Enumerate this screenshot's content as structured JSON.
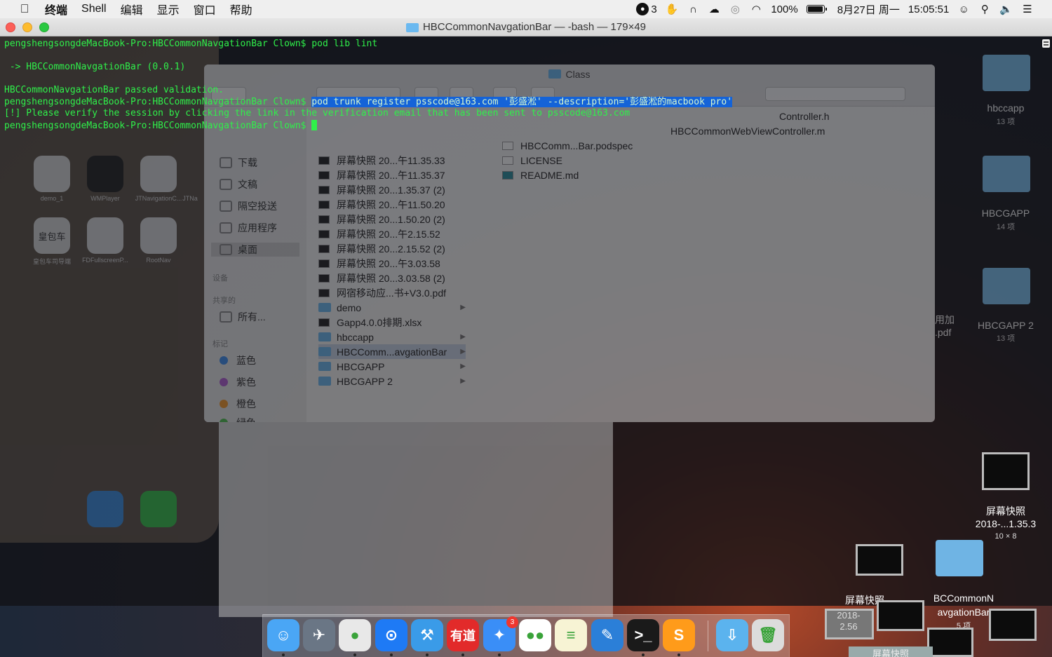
{
  "menubar": {
    "apple_icon": "apple-icon",
    "app_name": "终端",
    "menus": [
      "Shell",
      "编辑",
      "显示",
      "窗口",
      "帮助"
    ],
    "status": {
      "app_badge_count": "3",
      "battery_percent": "100%",
      "battery_level": 1.0,
      "date": "8月27日 周一",
      "time": "15:05:51"
    }
  },
  "terminal": {
    "window_title": "HBCCommonNavgationBar — -bash — 179×49",
    "lines": [
      {
        "pre": "pengshengsongdeMacBook-Pro:HBCCommonNavgationBar Clown$ pod lib lint",
        "hl": "",
        "post": ""
      },
      {
        "pre": "",
        "hl": "",
        "post": ""
      },
      {
        "pre": " -> HBCCommonNavgationBar (0.0.1)",
        "hl": "",
        "post": ""
      },
      {
        "pre": "",
        "hl": "",
        "post": ""
      },
      {
        "pre": "HBCCommonNavgationBar passed validation.",
        "hl": "",
        "post": ""
      },
      {
        "pre": "pengshengsongdeMacBook-Pro:HBCCommonNavgationBar Clown$ ",
        "hl": "pod trunk register psscode@163.com '彭盛淞' --description='彭盛淞的macbook pro'",
        "post": ""
      },
      {
        "pre": "[!] Please verify the session by clicking the link in the verification email that has been sent to psscode@163.com",
        "hl": "",
        "post": ""
      },
      {
        "pre": "pengshengsongdeMacBook-Pro:HBCCommonNavgationBar Clown$ ",
        "hl": "",
        "post": ""
      }
    ]
  },
  "background_finder": {
    "title": "Class",
    "sidebar": {
      "items": [
        "下载",
        "文稿",
        "隔空投送",
        "应用程序",
        "桌面"
      ],
      "sections": [
        "设备",
        "共享的",
        "标记"
      ],
      "shared_item": "所有...",
      "tags": [
        {
          "label": "蓝色",
          "color": "#3f8ff0"
        },
        {
          "label": "紫色",
          "color": "#b35fd6"
        },
        {
          "label": "橙色",
          "color": "#f59a2c"
        },
        {
          "label": "绿色",
          "color": "#4fc24f"
        }
      ]
    },
    "column1": [
      {
        "name": "屏幕快照 20...午11.35.33",
        "kind": "file"
      },
      {
        "name": "屏幕快照 20...午11.35.37",
        "kind": "file"
      },
      {
        "name": "屏幕快照 20...1.35.37 (2)",
        "kind": "file"
      },
      {
        "name": "屏幕快照 20...午11.50.20",
        "kind": "file"
      },
      {
        "name": "屏幕快照 20...1.50.20 (2)",
        "kind": "file"
      },
      {
        "name": "屏幕快照 20...午2.15.52",
        "kind": "file"
      },
      {
        "name": "屏幕快照 20...2.15.52 (2)",
        "kind": "file"
      },
      {
        "name": "屏幕快照 20...午3.03.58",
        "kind": "file"
      },
      {
        "name": "屏幕快照 20...3.03.58 (2)",
        "kind": "file"
      },
      {
        "name": "网宿移动应...书+V3.0.pdf",
        "kind": "file"
      },
      {
        "name": "demo",
        "kind": "folder"
      },
      {
        "name": "Gapp4.0.0排期.xlsx",
        "kind": "file"
      },
      {
        "name": "hbccapp",
        "kind": "folder"
      },
      {
        "name": "HBCComm...avgationBar",
        "kind": "folder"
      },
      {
        "name": "HBCGAPP",
        "kind": "folder"
      },
      {
        "name": "HBCGAPP 2",
        "kind": "folder"
      }
    ],
    "column2": [
      "Controller.h",
      "HBCCommonWebViewController.m",
      "HBCComm...Bar.podspec",
      "LICENSE",
      "README.md"
    ]
  },
  "simulator_ghost": {
    "apps": [
      "demo_1",
      "WMPlayer",
      "JTNavigationC...",
      "JTNa",
      "皇包车司导端",
      "FDFullscreenP...",
      "RootNav"
    ],
    "tile_text": "皇包车"
  },
  "desktop": {
    "items": [
      {
        "label": "hbccapp",
        "sub": "13 项"
      },
      {
        "label": "HBCGAPP",
        "sub": "14 项"
      },
      {
        "label": "HBCGAPP 2",
        "sub": "13 项"
      }
    ],
    "partial_label": "用加",
    "partial_sub": ".pdf",
    "screenshot_label": "屏幕快照",
    "screenshot_sub": "2018-...1.35.3",
    "screenshot_size": "10 × 8",
    "bottom_folder_label": "BCCommonN",
    "bottom_folder_label2": "avgationBar",
    "bottom_folder_sub": "5 项",
    "bottom_left_label": "屏幕快照",
    "bottom_small_1": "2018-",
    "bottom_small_2": "2.56",
    "bottom_last": "屏幕快照"
  },
  "dock": {
    "apps": [
      {
        "name": "finder-icon",
        "glyph": "☺",
        "color": "#4aa6f5"
      },
      {
        "name": "launchpad-icon",
        "glyph": "✈",
        "color": "#6a7685"
      },
      {
        "name": "chrome-icon",
        "glyph": "●",
        "color": "#e8e8e8"
      },
      {
        "name": "maps-pin-icon",
        "glyph": "⊙",
        "color": "#1e7af5"
      },
      {
        "name": "xcode-icon",
        "glyph": "⚒",
        "color": "#3a9be8"
      },
      {
        "name": "youdao-icon",
        "glyph": "有道",
        "color": "#e22a2a"
      },
      {
        "name": "dingtalk-icon",
        "glyph": "✦",
        "color": "#3a8ef7",
        "badge": "3"
      },
      {
        "name": "wechat-icon",
        "glyph": "●●",
        "color": "#ffffff"
      },
      {
        "name": "notes-icon",
        "glyph": "≡",
        "color": "#f7f3d4"
      },
      {
        "name": "xcode-blueprint-icon",
        "glyph": "✎",
        "color": "#2b7fd8"
      },
      {
        "name": "terminal-icon",
        "glyph": ">_",
        "color": "#1a1a1a"
      },
      {
        "name": "sublime-icon",
        "glyph": "S",
        "color": "#ff9b1a"
      },
      {
        "name": "downloads-folder-icon",
        "glyph": "⇩",
        "color": "#5bb3ee"
      },
      {
        "name": "trash-icon",
        "glyph": "🗑",
        "color": "#dcdcdc"
      }
    ]
  }
}
